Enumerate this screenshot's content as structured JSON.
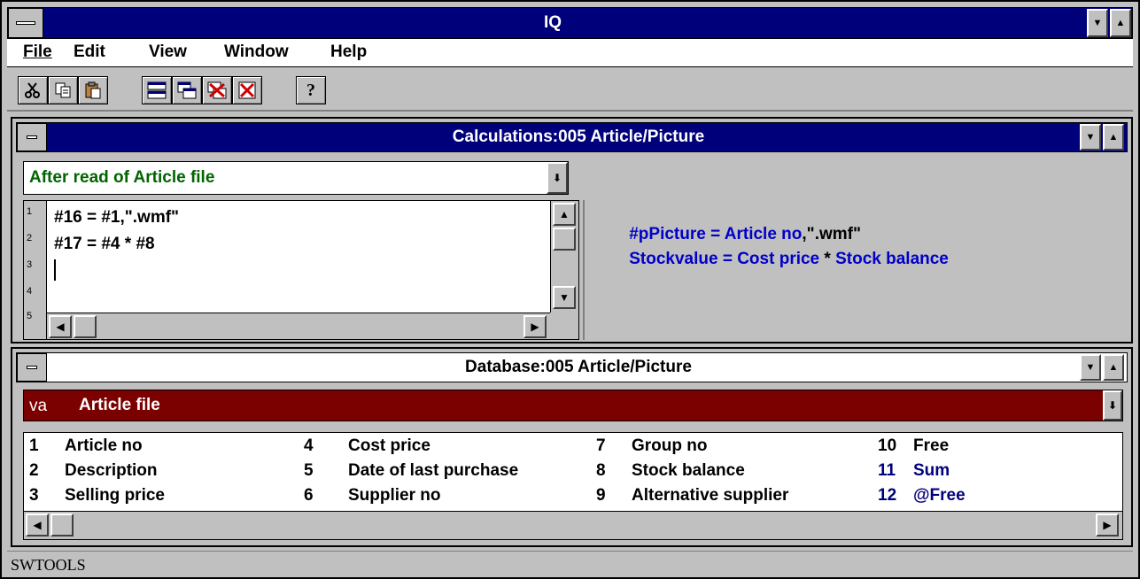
{
  "app": {
    "title": "IQ"
  },
  "menu": [
    {
      "label": "File"
    },
    {
      "label": "Edit"
    },
    {
      "label": "View"
    },
    {
      "label": "Window"
    },
    {
      "label": "Help"
    }
  ],
  "toolbar": {
    "icons": [
      "cut-icon",
      "copy-icon",
      "paste-icon",
      "tile-icon",
      "cascade-icon",
      "close-all-icon",
      "close-icon",
      "help-icon"
    ],
    "help_glyph": "?"
  },
  "calc_window": {
    "title": "Calculations:005  Article/Picture",
    "event_select": "After read of Article file",
    "line_numbers": [
      "1",
      "2",
      "3",
      "4",
      "5"
    ],
    "code_lines": [
      "#16 = #1,\".wmf\"",
      "#17 = #4 * #8",
      ""
    ],
    "translation_lines": [
      {
        "parts": [
          {
            "t": "#pPicture = Article no",
            "c": "blue"
          },
          {
            "t": ",\".wmf\"",
            "c": "black"
          }
        ]
      },
      {
        "parts": [
          {
            "t": "Stockvalue = Cost price",
            "c": "blue"
          },
          {
            "t": " * ",
            "c": "black"
          },
          {
            "t": "Stock balance",
            "c": "blue"
          }
        ]
      }
    ]
  },
  "db_window": {
    "title": "Database:005  Article/Picture",
    "file_code": "va",
    "file_name": "Article file",
    "fields": [
      {
        "num": "1",
        "name": "Article no",
        "col": 0,
        "row": 0,
        "color": "black"
      },
      {
        "num": "2",
        "name": "Description",
        "col": 0,
        "row": 1,
        "color": "black"
      },
      {
        "num": "3",
        "name": "Selling price",
        "col": 0,
        "row": 2,
        "color": "black"
      },
      {
        "num": "4",
        "name": "Cost price",
        "col": 1,
        "row": 0,
        "color": "black"
      },
      {
        "num": "5",
        "name": "Date of last purchase",
        "col": 1,
        "row": 1,
        "color": "black"
      },
      {
        "num": "6",
        "name": "Supplier no",
        "col": 1,
        "row": 2,
        "color": "black"
      },
      {
        "num": "7",
        "name": "Group no",
        "col": 2,
        "row": 0,
        "color": "black"
      },
      {
        "num": "8",
        "name": "Stock balance",
        "col": 2,
        "row": 1,
        "color": "black"
      },
      {
        "num": "9",
        "name": "Alternative supplier",
        "col": 2,
        "row": 2,
        "color": "black"
      },
      {
        "num": "10",
        "name": "Free",
        "col": 3,
        "row": 0,
        "color": "black"
      },
      {
        "num": "11",
        "name": "Sum",
        "col": 3,
        "row": 1,
        "color": "blue"
      },
      {
        "num": "12",
        "name": "@Free",
        "col": 3,
        "row": 2,
        "color": "blue"
      }
    ]
  },
  "status": {
    "text": "SWTOOLS"
  },
  "colors": {
    "titlebar": "#00007b",
    "db_file_bar": "#7b0000",
    "event_text": "#006400",
    "link_text": "#0000c8"
  }
}
